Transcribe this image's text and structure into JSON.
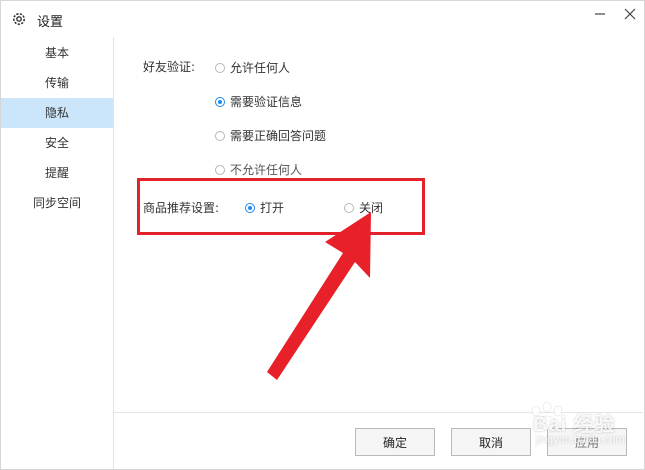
{
  "window": {
    "title": "设置"
  },
  "sidebar": {
    "items": [
      {
        "label": "基本"
      },
      {
        "label": "传输"
      },
      {
        "label": "隐私"
      },
      {
        "label": "安全"
      },
      {
        "label": "提醒"
      },
      {
        "label": "同步空间"
      }
    ],
    "selected": "隐私"
  },
  "friend_verification": {
    "label": "好友验证:",
    "options": [
      {
        "label": "允许任何人",
        "checked": false
      },
      {
        "label": "需要验证信息",
        "checked": true
      },
      {
        "label": "需要正确回答问题",
        "checked": false
      },
      {
        "label": "不允许任何人",
        "checked": false
      }
    ]
  },
  "product_recommend": {
    "label": "商品推荐设置:",
    "options": [
      {
        "label": "打开",
        "checked": true
      },
      {
        "label": "关闭",
        "checked": false
      }
    ]
  },
  "buttons": {
    "ok": "确定",
    "cancel": "取消",
    "apply": "应用"
  },
  "watermark": {
    "brand": "Bai 经验",
    "sub": "jingyan.baidu.com"
  },
  "colors": {
    "accent": "#1b8cf0",
    "highlight_box": "#e3222b",
    "arrow": "#e8202a",
    "selected_nav": "#cbe6fa"
  },
  "icons": {
    "title": "gear-icon",
    "minimize": "minimize-icon",
    "close": "close-icon"
  }
}
